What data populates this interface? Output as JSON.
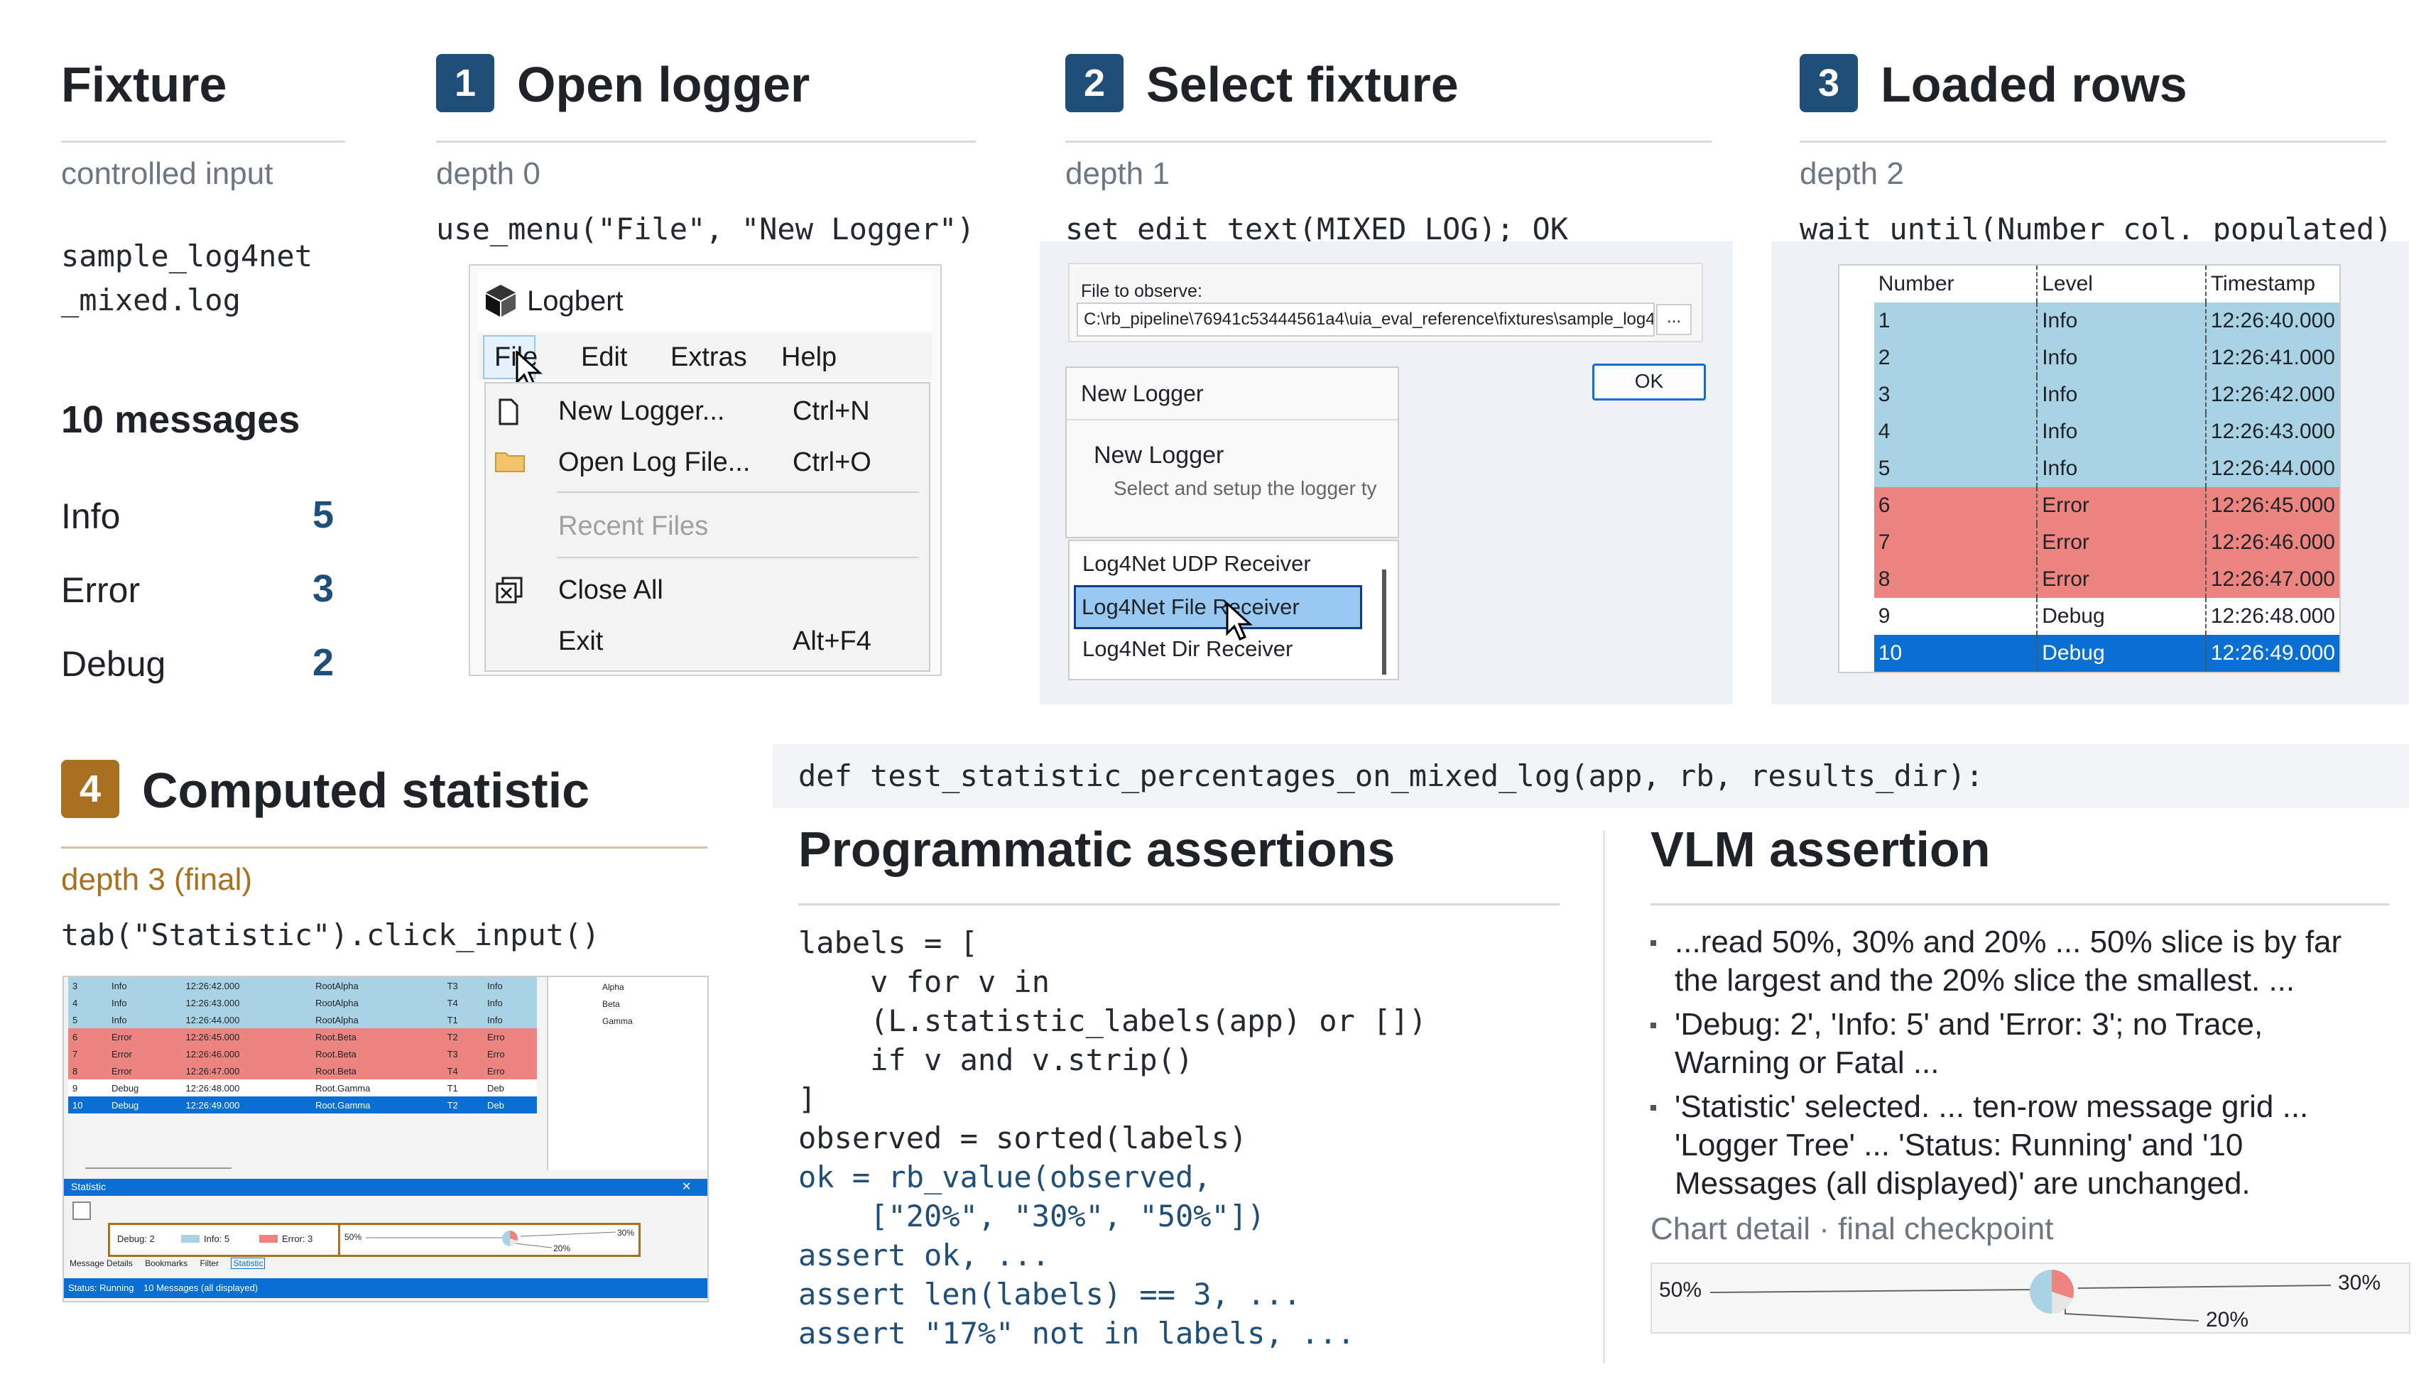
{
  "fixture": {
    "title": "Fixture",
    "subtitle": "controlled input",
    "filename_line1": "sample_log4net",
    "filename_line2": "_mixed.log",
    "messages_heading": "10 messages",
    "counts": [
      {
        "label": "Info",
        "value": "5"
      },
      {
        "label": "Error",
        "value": "3"
      },
      {
        "label": "Debug",
        "value": "2"
      }
    ]
  },
  "step1": {
    "number": "1",
    "title": "Open logger",
    "depth": "depth 0",
    "code": "use_menu(\"File\", \"New Logger\")",
    "app_title": "Logbert",
    "menubar": [
      "File",
      "Edit",
      "Extras",
      "Help"
    ],
    "menu_items": [
      {
        "label": "New Logger...",
        "shortcut": "Ctrl+N"
      },
      {
        "label": "Open Log File...",
        "shortcut": "Ctrl+O"
      },
      {
        "label": "Recent Files",
        "shortcut": ""
      },
      {
        "label": "Close All",
        "shortcut": ""
      },
      {
        "label": "Exit",
        "shortcut": "Alt+F4"
      }
    ]
  },
  "step2": {
    "number": "2",
    "title": "Select fixture",
    "depth": "depth 1",
    "code": "set_edit_text(MIXED_LOG); OK",
    "file_label": "File to observe:",
    "file_path": "C:\\rb_pipeline\\76941c53444561a4\\uia_eval_reference\\fixtures\\sample_log4r",
    "browse": "...",
    "ok": "OK",
    "dialog_title": "New Logger",
    "dialog_heading": "New Logger",
    "dialog_sub": "Select and setup the logger ty",
    "receivers": [
      "Log4Net UDP Receiver",
      "Log4Net File Receiver",
      "Log4Net Dir Receiver"
    ]
  },
  "step3": {
    "number": "3",
    "title": "Loaded rows",
    "depth": "depth 2",
    "code": "wait_until(Number col. populated)",
    "columns": [
      "Number",
      "Level",
      "Timestamp"
    ],
    "rows": [
      [
        "1",
        "Info",
        "12:26:40.000"
      ],
      [
        "2",
        "Info",
        "12:26:41.000"
      ],
      [
        "3",
        "Info",
        "12:26:42.000"
      ],
      [
        "4",
        "Info",
        "12:26:43.000"
      ],
      [
        "5",
        "Info",
        "12:26:44.000"
      ],
      [
        "6",
        "Error",
        "12:26:45.000"
      ],
      [
        "7",
        "Error",
        "12:26:46.000"
      ],
      [
        "8",
        "Error",
        "12:26:47.000"
      ],
      [
        "9",
        "Debug",
        "12:26:48.000"
      ],
      [
        "10",
        "Debug",
        "12:26:49.000"
      ]
    ]
  },
  "step4": {
    "number": "4",
    "title": "Computed statistic",
    "depth": "depth 3 (final)",
    "code": "tab(\"Statistic\").click_input()",
    "mini_rows": [
      [
        "3",
        "Info",
        "12:26:42.000",
        "RootAlpha",
        "T3",
        "Info"
      ],
      [
        "4",
        "Info",
        "12:26:43.000",
        "RootAlpha",
        "T4",
        "Info"
      ],
      [
        "5",
        "Info",
        "12:26:44.000",
        "RootAlpha",
        "T1",
        "Info"
      ],
      [
        "6",
        "Error",
        "12:26:45.000",
        "Root.Beta",
        "T2",
        "Erro"
      ],
      [
        "7",
        "Error",
        "12:26:46.000",
        "Root.Beta",
        "T3",
        "Erro"
      ],
      [
        "8",
        "Error",
        "12:26:47.000",
        "Root.Beta",
        "T4",
        "Erro"
      ],
      [
        "9",
        "Debug",
        "12:26:48.000",
        "Root.Gamma",
        "T1",
        "Deb"
      ],
      [
        "10",
        "Debug",
        "12:26:49.000",
        "Root.Gamma",
        "T2",
        "Deb"
      ]
    ],
    "tree_items": [
      "Alpha",
      "Beta",
      "Gamma"
    ],
    "panel_title": "Statistic",
    "legend": [
      {
        "label": "Debug: 2"
      },
      {
        "label": "Info: 5"
      },
      {
        "label": "Error: 3"
      }
    ],
    "mini_labels": [
      "50%",
      "30%",
      "20%"
    ],
    "tabs": [
      "Message Details",
      "Bookmarks",
      "Filter",
      "Statistic"
    ],
    "status_left": "Status: Running",
    "status_right": "10 Messages (all displayed)"
  },
  "test_signature": "def test_statistic_percentages_on_mixed_log(app, rb, results_dir):",
  "programmatic": {
    "title": "Programmatic assertions",
    "lines": [
      {
        "text": "labels = [",
        "color": "#24292f"
      },
      {
        "text": "    v for v in",
        "color": "#24292f"
      },
      {
        "text": "    (L.statistic_labels(app) or [])",
        "color": "#24292f"
      },
      {
        "text": "    if v and v.strip()",
        "color": "#24292f"
      },
      {
        "text": "]",
        "color": "#24292f"
      },
      {
        "text": "observed = sorted(labels)",
        "color": "#24292f"
      },
      {
        "text": "ok = rb_value(observed,",
        "color": "#1f4e79"
      },
      {
        "text": "    [\"20%\", \"30%\", \"50%\"])",
        "color": "#1f4e79"
      },
      {
        "text": "assert ok, ...",
        "color": "#1f4e79"
      },
      {
        "text": "assert len(labels) == 3, ...",
        "color": "#1f4e79"
      },
      {
        "text": "assert \"17%\" not in labels, ...",
        "color": "#1f4e79"
      }
    ]
  },
  "vlm": {
    "title": "VLM assertion",
    "bullets": [
      [
        "...read 50%, 30% and 20% ... 50% slice is by far",
        "the largest and the 20% slice the smallest. ..."
      ],
      [
        "'Debug: 2', 'Info: 5' and 'Error: 3'; no Trace,",
        "Warning or Fatal ..."
      ],
      [
        "'Statistic' selected. ... ten-row message grid ...",
        "'Logger Tree' ... 'Status: Running' and '10",
        "Messages (all displayed)' are unchanged."
      ]
    ],
    "caption": "Chart detail · final checkpoint",
    "detail_labels": [
      "50%",
      "30%",
      "20%"
    ]
  },
  "colors": {
    "accent": "#1f4e79",
    "final_accent": "#a8701f",
    "info_row": "#a9d3e4",
    "error_row": "#ec8480",
    "selected_row": "#0a6fd2"
  }
}
